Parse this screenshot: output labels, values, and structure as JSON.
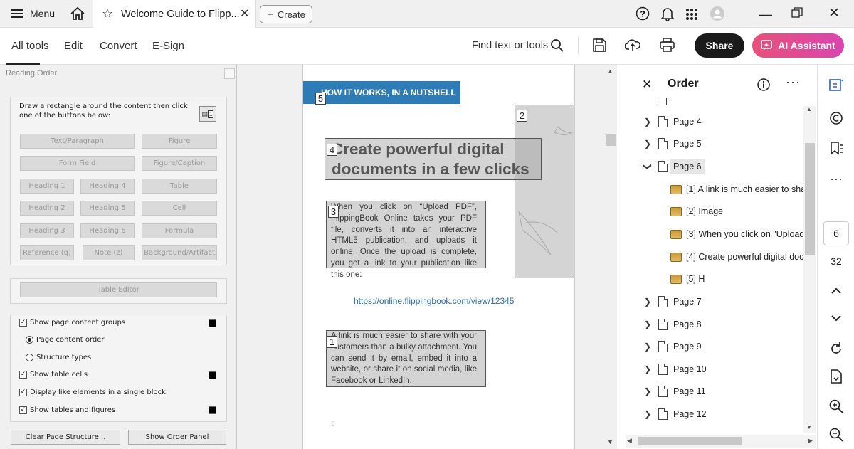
{
  "tabbar": {
    "menu_label": "Menu",
    "tab_title": "Welcome Guide to Flipp...",
    "create_label": "Create"
  },
  "toolbar": {
    "tabs": [
      "All tools",
      "Edit",
      "Convert",
      "E-Sign"
    ],
    "find_label": "Find text or tools",
    "share_label": "Share",
    "ai_label": "AI Assistant"
  },
  "reading_order": {
    "title": "Reading Order",
    "instruction": "Draw a rectangle around the content then click one of the buttons below:",
    "buttons": {
      "text_paragraph": "Text/Paragraph",
      "figure": "Figure",
      "form_field": "Form Field",
      "figure_caption": "Figure/Caption",
      "heading1": "Heading 1",
      "heading4": "Heading 4",
      "table": "Table",
      "heading2": "Heading 2",
      "heading5": "Heading 5",
      "cell": "Cell",
      "heading3": "Heading 3",
      "heading6": "Heading 6",
      "formula": "Formula",
      "reference": "Reference (q)",
      "note": "Note (z)",
      "background": "Background/Artifact"
    },
    "table_editor": "Table Editor",
    "options": {
      "show_page_content_groups": "Show page content groups",
      "page_content_order": "Page content order",
      "structure_types": "Structure types",
      "show_table_cells": "Show table cells",
      "display_like_elements": "Display like elements in a single block",
      "show_tables_figures": "Show tables and figures"
    },
    "clear_button": "Clear Page Structure...",
    "show_order_button": "Show Order Panel"
  },
  "document": {
    "banner": "HOW IT WORKS, IN A NUTSHELL",
    "headline_line1": "Create powerful digital",
    "headline_line2": "documents in a few clicks",
    "para1": "When you click on “Upload PDF”, FlippingBook Online takes your PDF file, converts it into an interactive HTML5 publication, and uploads it online. Once the upload is complete, you get a link to your publication like this one:",
    "link": "https://online.flippingbook.com/view/12345",
    "para2": "A link is much easier to share with your customers than a bulky attachment. You can send it by email, embed it into a website, or share it on social media, like Facebook or LinkedIn.",
    "box_numbers": [
      "5",
      "2",
      "4",
      "3",
      "1"
    ],
    "page_number": "6"
  },
  "order_panel": {
    "title": "Order",
    "pages": [
      "Page 4",
      "Page 5",
      "Page 6",
      "Page 7",
      "Page 8",
      "Page 9",
      "Page 10",
      "Page 11",
      "Page 12"
    ],
    "children": [
      "[1]  A link is much easier to shar",
      "[2]  Image",
      "[3]  When you click on \"Upload",
      "[4]  Create powerful digital docu",
      "[5]  H"
    ]
  },
  "rail": {
    "current_page": "6",
    "total_pages": "32"
  }
}
